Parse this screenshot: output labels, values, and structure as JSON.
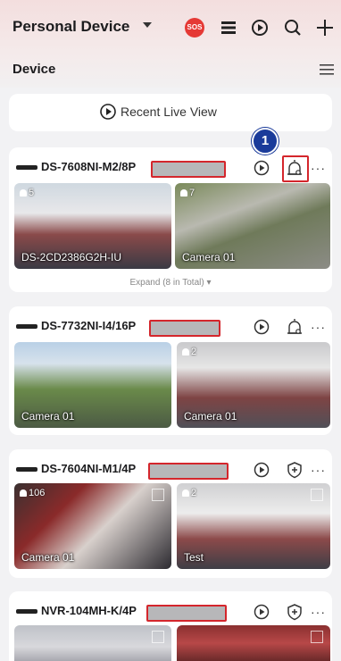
{
  "header": {
    "title": "Personal Device",
    "sos_label": "SOS"
  },
  "subheader": {
    "title": "Device"
  },
  "live_view": {
    "label": "Recent Live View"
  },
  "callout": {
    "number": "1"
  },
  "devices": [
    {
      "name": "DS-7608NI-M2/8P",
      "expand": "Expand (8 in Total) ▾",
      "cameras": [
        {
          "label": "DS-2CD2386G2H-IU",
          "badge": "5"
        },
        {
          "label": "Camera 01",
          "badge": "7"
        }
      ]
    },
    {
      "name": "DS-7732NI-I4/16P",
      "cameras": [
        {
          "label": "Camera 01",
          "badge": ""
        },
        {
          "label": "Camera 01",
          "badge": "2"
        }
      ]
    },
    {
      "name": "DS-7604NI-M1/4P",
      "cameras": [
        {
          "label": "Camera 01",
          "badge": "106"
        },
        {
          "label": "Test",
          "badge": "2"
        }
      ]
    },
    {
      "name": "NVR-104MH-K/4P",
      "cameras": [
        {
          "label": "",
          "badge": ""
        },
        {
          "label": "",
          "badge": ""
        }
      ]
    }
  ]
}
